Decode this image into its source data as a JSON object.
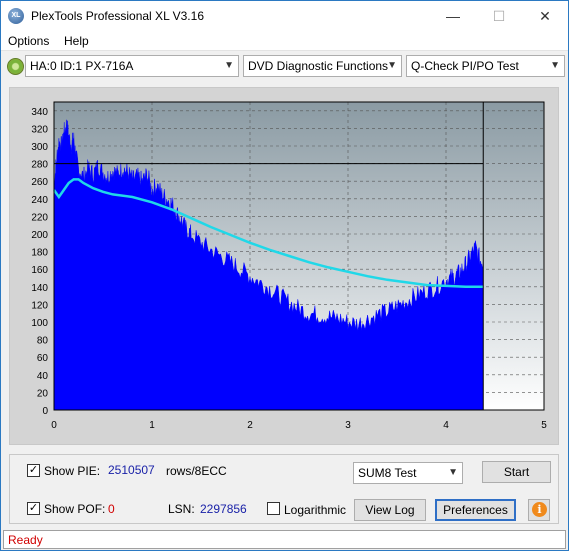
{
  "window": {
    "title": "PlexTools Professional XL V3.16"
  },
  "title_buttons": {
    "minimize": "—",
    "maximize": "☐",
    "close": "✕"
  },
  "icons": {
    "app": "XL",
    "drive": "disc-drive-icon",
    "info": "i"
  },
  "menu": {
    "options": "Options",
    "help": "Help"
  },
  "toolbar": {
    "drive": "HA:0 ID:1  PX-716A",
    "function": "DVD Diagnostic Functions",
    "test": "Q-Check PI/PO Test"
  },
  "colors": {
    "pie_fill": "#0000ff",
    "pie_avg_line": "#20d8e8",
    "plot_bg_top": "#8a9aa3",
    "plot_bg_bottom": "#ffffff"
  },
  "chart_data": {
    "type": "area",
    "title": "",
    "xlabel": "",
    "ylabel": "",
    "xlim": [
      0,
      5
    ],
    "ylim": [
      0,
      350
    ],
    "x_ticks": [
      "0",
      "1",
      "2",
      "3",
      "4",
      "5"
    ],
    "y_ticks": [
      "0",
      "20",
      "40",
      "60",
      "80",
      "100",
      "120",
      "140",
      "160",
      "180",
      "200",
      "220",
      "240",
      "260",
      "280",
      "300",
      "320",
      "340"
    ],
    "grid": true,
    "marker_x": 4.38,
    "marker_y": 280,
    "series": [
      {
        "style": "filled-area",
        "color": "#0000ff",
        "x": [
          0,
          0.02,
          0.05,
          0.08,
          0.1,
          0.13,
          0.15,
          0.18,
          0.2,
          0.22,
          0.25,
          0.3,
          0.35,
          0.4,
          0.45,
          0.5,
          0.55,
          0.6,
          0.65,
          0.7,
          0.75,
          0.8,
          0.85,
          0.9,
          0.95,
          1.0,
          1.05,
          1.1,
          1.15,
          1.2,
          1.25,
          1.3,
          1.35,
          1.4,
          1.5,
          1.6,
          1.7,
          1.8,
          1.9,
          2.0,
          2.1,
          2.2,
          2.3,
          2.4,
          2.5,
          2.6,
          2.7,
          2.8,
          2.9,
          3.0,
          3.1,
          3.2,
          3.3,
          3.4,
          3.5,
          3.6,
          3.7,
          3.8,
          3.9,
          4.0,
          4.05,
          4.1,
          4.15,
          4.2,
          4.25,
          4.3,
          4.35,
          4.38
        ],
        "y": [
          250,
          280,
          305,
          300,
          315,
          325,
          310,
          300,
          310,
          290,
          275,
          265,
          275,
          268,
          278,
          270,
          265,
          272,
          268,
          275,
          270,
          262,
          265,
          260,
          268,
          250,
          255,
          245,
          240,
          235,
          225,
          215,
          205,
          200,
          190,
          182,
          175,
          168,
          160,
          152,
          145,
          138,
          130,
          122,
          115,
          110,
          108,
          106,
          104,
          100,
          98,
          103,
          108,
          112,
          118,
          124,
          130,
          136,
          140,
          148,
          150,
          152,
          158,
          165,
          175,
          185,
          170,
          168
        ]
      },
      {
        "style": "line",
        "color": "#20d8e8",
        "x": [
          0,
          0.05,
          0.1,
          0.15,
          0.2,
          0.25,
          0.3,
          0.4,
          0.5,
          0.6,
          0.8,
          1.0,
          1.2,
          1.4,
          1.6,
          1.8,
          2.0,
          2.2,
          2.4,
          2.6,
          2.8,
          3.0,
          3.2,
          3.4,
          3.6,
          3.8,
          4.0,
          4.2,
          4.38
        ],
        "y": [
          250,
          242,
          250,
          258,
          262,
          262,
          258,
          252,
          248,
          245,
          242,
          236,
          228,
          218,
          208,
          199,
          190,
          182,
          175,
          168,
          162,
          157,
          152,
          148,
          145,
          142,
          141,
          140,
          140
        ]
      }
    ]
  },
  "controls": {
    "show_pie_label": "Show PIE:",
    "show_pie_checked": "✓",
    "pie_value": "2510507",
    "pie_unit": "rows/8ECC",
    "show_pof_label": "Show POF:",
    "show_pof_checked": "✓",
    "pof_value": "0",
    "lsn_label": "LSN:",
    "lsn_value": "2297856",
    "logarithmic_label": "Logarithmic",
    "test_select": "SUM8 Test",
    "start_button": "Start",
    "view_log_button": "View Log",
    "preferences_button": "Preferences"
  },
  "status": {
    "text": "Ready"
  }
}
